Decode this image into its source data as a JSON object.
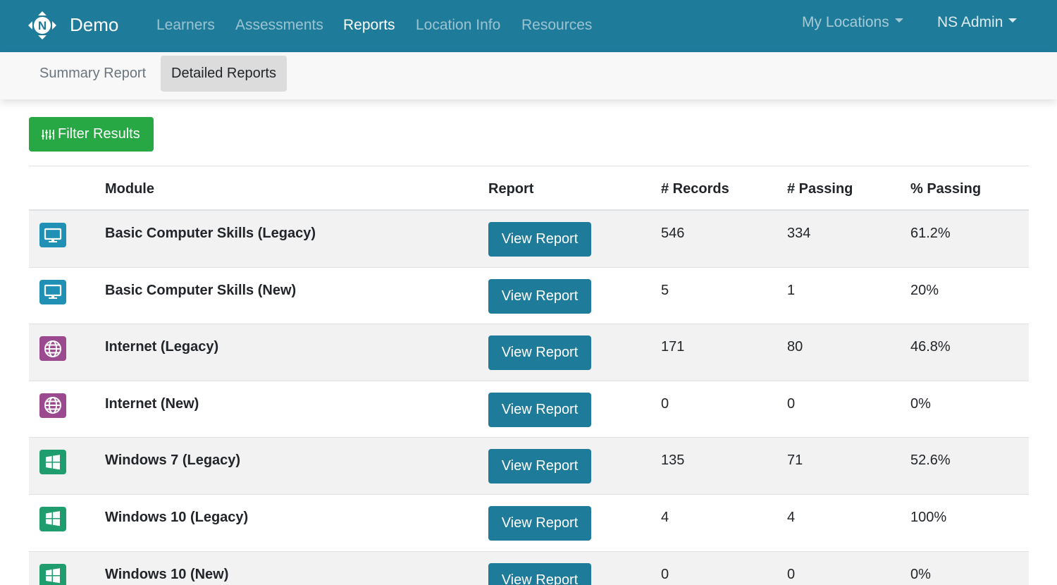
{
  "colors": {
    "navbar": "#1f7b9a",
    "filter_button": "#28a745",
    "view_button": "#1f7b9a",
    "computer_icon": "#2090b5",
    "internet_icon": "#9c4a8f",
    "windows_icon": "#1f9d6e"
  },
  "brand": {
    "name": "Demo",
    "logo_icon": "northstar-logo-icon"
  },
  "nav": {
    "links": [
      "Learners",
      "Assessments",
      "Reports",
      "Location Info",
      "Resources"
    ],
    "active": "Reports",
    "locations_label": "My Locations",
    "user_label": "NS Admin"
  },
  "subnav": {
    "tabs": [
      "Summary Report",
      "Detailed Reports"
    ],
    "active": "Detailed Reports"
  },
  "filter": {
    "label": "Filter Results",
    "icon": "sliders-icon"
  },
  "table": {
    "headers": {
      "module": "Module",
      "report": "Report",
      "records": "# Records",
      "passing": "# Passing",
      "percent": "% Passing"
    },
    "view_label": "View Report",
    "rows": [
      {
        "module": "Basic Computer Skills (Legacy)",
        "icon": "computer-icon",
        "records": "546",
        "passing": "334",
        "percent": "61.2%"
      },
      {
        "module": "Basic Computer Skills (New)",
        "icon": "computer-icon",
        "records": "5",
        "passing": "1",
        "percent": "20%"
      },
      {
        "module": "Internet (Legacy)",
        "icon": "globe-icon",
        "records": "171",
        "passing": "80",
        "percent": "46.8%"
      },
      {
        "module": "Internet (New)",
        "icon": "globe-icon",
        "records": "0",
        "passing": "0",
        "percent": "0%"
      },
      {
        "module": "Windows 7 (Legacy)",
        "icon": "windows-icon",
        "records": "135",
        "passing": "71",
        "percent": "52.6%"
      },
      {
        "module": "Windows 10 (Legacy)",
        "icon": "windows-icon",
        "records": "4",
        "passing": "4",
        "percent": "100%"
      },
      {
        "module": "Windows 10 (New)",
        "icon": "windows-icon",
        "records": "0",
        "passing": "0",
        "percent": "0%"
      }
    ]
  }
}
